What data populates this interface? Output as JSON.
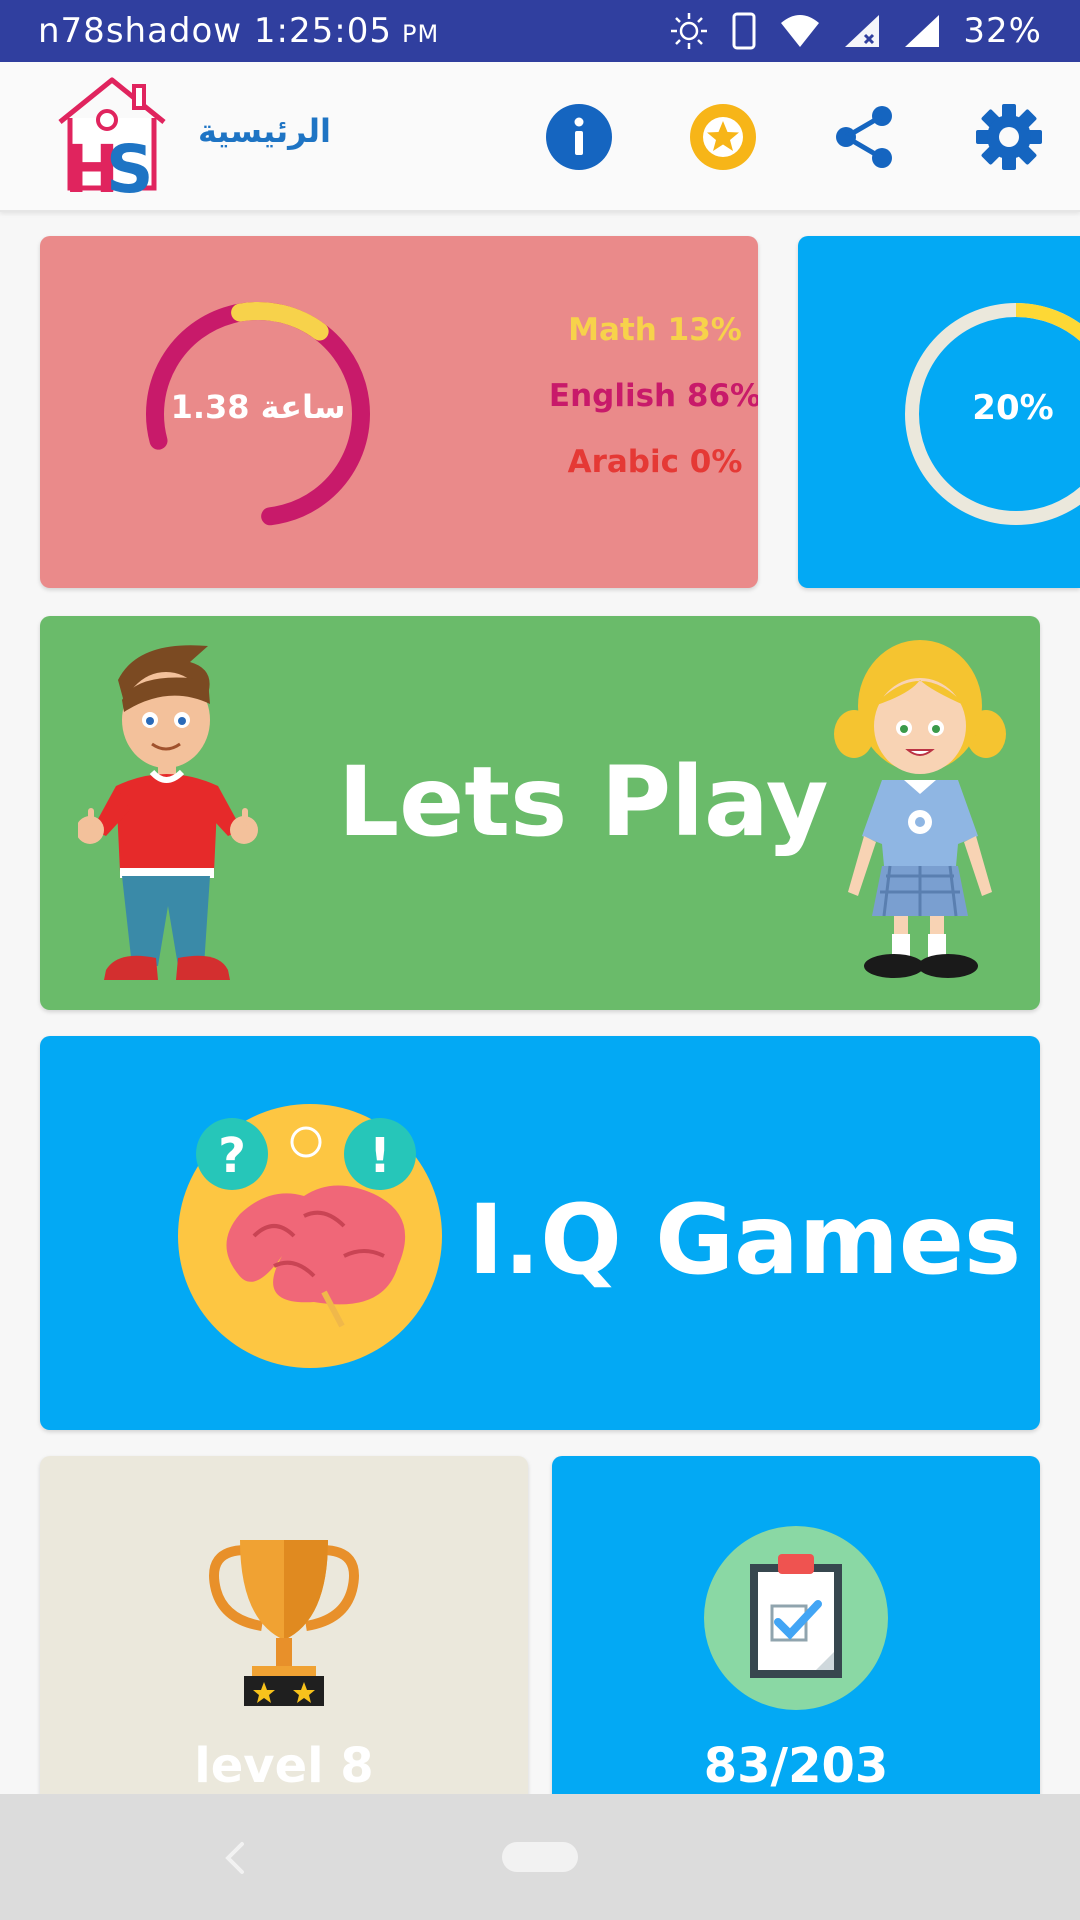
{
  "status_bar": {
    "carrier_time": "n78shadow 1:25:05",
    "ampm": "PM",
    "battery": "32%"
  },
  "app_bar": {
    "logo_text": "HS",
    "title": "الرئيسية",
    "icons": [
      "info-icon",
      "star-icon",
      "share-icon",
      "settings-icon"
    ]
  },
  "progress_card": {
    "hours_label": "ساعة 1.38",
    "subjects": [
      {
        "label": "Math 13%",
        "color": "#f7d24b"
      },
      {
        "label": "English 86%",
        "color": "#c81a6a"
      },
      {
        "label": "Arabic 0%",
        "color": "#e53935"
      }
    ],
    "ring_progress": 0.13
  },
  "completion_card": {
    "percent_label": "20%",
    "ring_progress": 0.2
  },
  "play_card": {
    "title": "Lets Play"
  },
  "iq_card": {
    "title": "I.Q Games"
  },
  "level_card": {
    "label": "level 8"
  },
  "tasks_card": {
    "label": "83/203"
  },
  "colors": {
    "status_bar": "#303f9f",
    "accent_blue": "#1e74c4",
    "card_pink": "#ea8a8a",
    "card_blue": "#03a9f4",
    "card_green": "#6abb6a",
    "card_beige": "#ebe8dc",
    "star_yellow": "#f7b518"
  }
}
